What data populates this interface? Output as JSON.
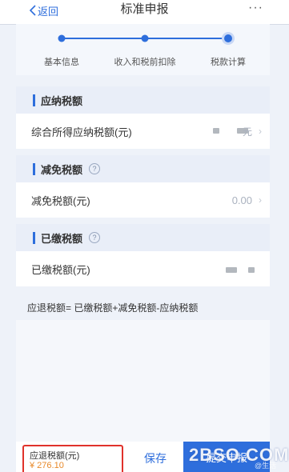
{
  "header": {
    "back_label": "返回",
    "title": "标准申报",
    "more_label": "···"
  },
  "steps": [
    {
      "label": "基本信息",
      "state": "done"
    },
    {
      "label": "收入和税前扣除",
      "state": "done"
    },
    {
      "label": "税款计算",
      "state": "current"
    }
  ],
  "sections": {
    "payable": {
      "title": "应纳税额",
      "row_label": "综合所得应纳税额(元)",
      "row_value_suffix": "元"
    },
    "reduction": {
      "title": "减免税额",
      "help": "?",
      "row_label": "减免税额(元)",
      "row_value": "0.00"
    },
    "paid": {
      "title": "已缴税额",
      "help": "?",
      "row_label": "已缴税额(元)"
    }
  },
  "formula": "应退税额= 已缴税额+减免税额-应纳税额",
  "footer": {
    "refund_label": "应退税额(元)",
    "refund_amount": "¥ 276.10",
    "save_label": "保存",
    "submit_label": "提交申报",
    "watermark": "2BSO.COM",
    "watermark_small": "@生活"
  },
  "colors": {
    "accent": "#2e6edc",
    "highlight_border": "#e0322b",
    "amount": "#e8892a"
  }
}
